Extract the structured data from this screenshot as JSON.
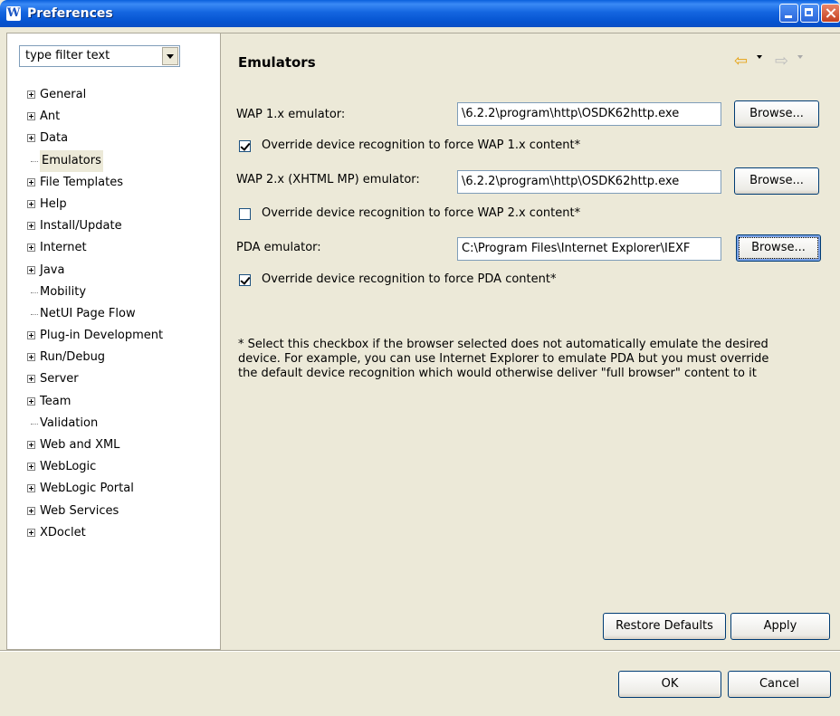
{
  "window": {
    "title": "Preferences",
    "app_icon_glyph": "W"
  },
  "filter": {
    "value": "type filter text"
  },
  "tree": {
    "items": [
      {
        "label": "General",
        "expandable": true
      },
      {
        "label": "Ant",
        "expandable": true
      },
      {
        "label": "Data",
        "expandable": true
      },
      {
        "label": "Emulators",
        "expandable": false,
        "selected": true
      },
      {
        "label": "File Templates",
        "expandable": true
      },
      {
        "label": "Help",
        "expandable": true
      },
      {
        "label": "Install/Update",
        "expandable": true
      },
      {
        "label": "Internet",
        "expandable": true
      },
      {
        "label": "Java",
        "expandable": true
      },
      {
        "label": "Mobility",
        "expandable": false
      },
      {
        "label": "NetUI Page Flow",
        "expandable": false
      },
      {
        "label": "Plug-in Development",
        "expandable": true
      },
      {
        "label": "Run/Debug",
        "expandable": true
      },
      {
        "label": "Server",
        "expandable": true
      },
      {
        "label": "Team",
        "expandable": true
      },
      {
        "label": "Validation",
        "expandable": false
      },
      {
        "label": "Web and XML",
        "expandable": true
      },
      {
        "label": "WebLogic",
        "expandable": true
      },
      {
        "label": "WebLogic Portal",
        "expandable": true
      },
      {
        "label": "Web Services",
        "expandable": true
      },
      {
        "label": "XDoclet",
        "expandable": true
      }
    ]
  },
  "page": {
    "title": "Emulators",
    "nav": {
      "back_icon": "back-arrow-icon",
      "forward_icon": "forward-arrow-icon"
    }
  },
  "form": {
    "wap1": {
      "label": "WAP 1.x emulator:",
      "value": "\\6.2.2\\program\\http\\OSDK62http.exe",
      "browse": "Browse...",
      "override_label": "Override device recognition to force WAP 1.x content*",
      "override_checked": true
    },
    "wap2": {
      "label": "WAP 2.x (XHTML MP) emulator:",
      "value": "\\6.2.2\\program\\http\\OSDK62http.exe",
      "browse": "Browse...",
      "override_label": "Override device recognition to force WAP 2.x content*",
      "override_checked": false
    },
    "pda": {
      "label": "PDA emulator:",
      "value": "C:\\Program Files\\Internet Explorer\\IEXF",
      "browse": "Browse...",
      "override_label": "Override device recognition to force PDA content*",
      "override_checked": true
    },
    "note": "* Select this checkbox if the browser selected does not automatically emulate the desired device. For example, you can use Internet Explorer to emulate PDA but you must override the default device recognition which would otherwise deliver \"full browser\" content to it"
  },
  "buttons": {
    "restore_defaults": "Restore Defaults",
    "apply": "Apply",
    "ok": "OK",
    "cancel": "Cancel"
  }
}
